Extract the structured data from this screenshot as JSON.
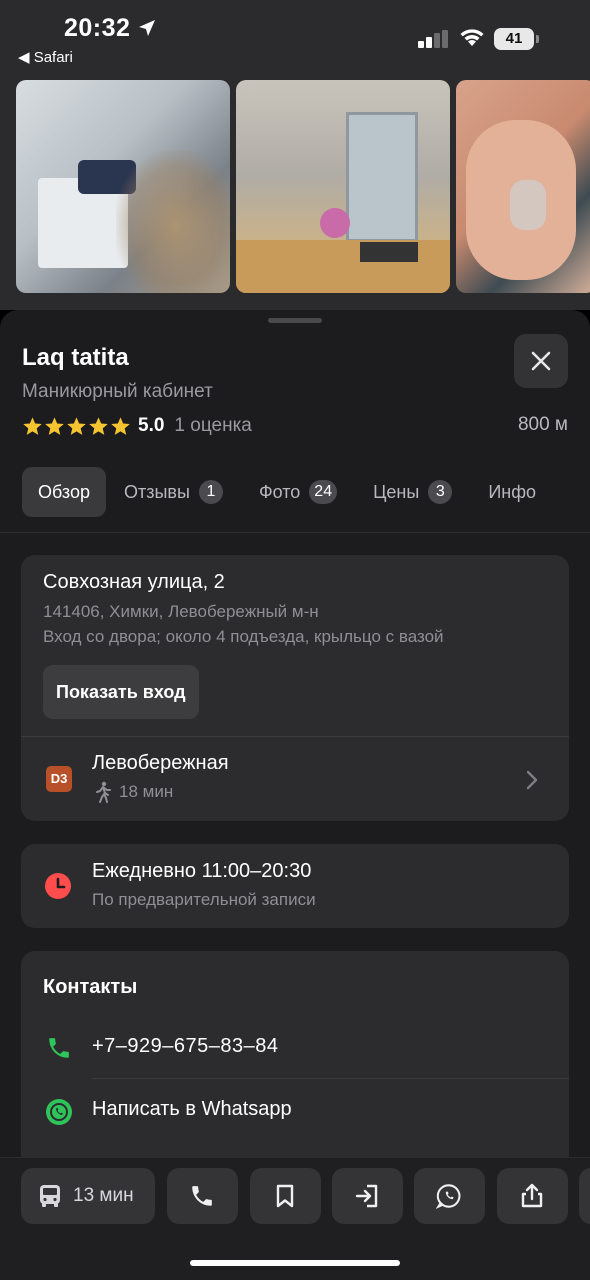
{
  "status_bar": {
    "time": "20:32",
    "back_app": "◀ Safari",
    "battery": "41"
  },
  "place": {
    "name": "Laq tatita",
    "category": "Маникюрный кабинет",
    "rating": "5.0",
    "rating_count": "1 оценка",
    "distance": "800 м",
    "star_color": "#f5c531"
  },
  "tabs": [
    {
      "label": "Обзор",
      "badge": null
    },
    {
      "label": "Отзывы",
      "badge": "1"
    },
    {
      "label": "Фото",
      "badge": "24"
    },
    {
      "label": "Цены",
      "badge": "3"
    },
    {
      "label": "Инфо",
      "badge": null
    }
  ],
  "address": {
    "street": "Совхозная улица, 2",
    "locality": "141406, Химки, Левобережный м-н",
    "entrance_note": "Вход со двора; около 4 подъезда, крыльцо с вазой",
    "show_entrance_label": "Показать вход",
    "metro": {
      "line_badge": "D3",
      "line_color": "#b8512a",
      "station": "Левобережная",
      "walk_time": "18 мин"
    }
  },
  "hours": {
    "schedule": "Ежедневно 11:00–20:30",
    "note": "По предварительной записи",
    "icon_color": "#ff4d4d"
  },
  "contacts": {
    "title": "Контакты",
    "phone": "+7–929–675–83–84",
    "whatsapp_label": "Написать в Whatsapp",
    "accent_color": "#2fc45a"
  },
  "action_bar": {
    "route_time": "13 мин",
    "icons": [
      "bus-icon",
      "phone-icon",
      "bookmark-icon",
      "enter-icon",
      "whatsapp-icon",
      "share-icon"
    ]
  }
}
